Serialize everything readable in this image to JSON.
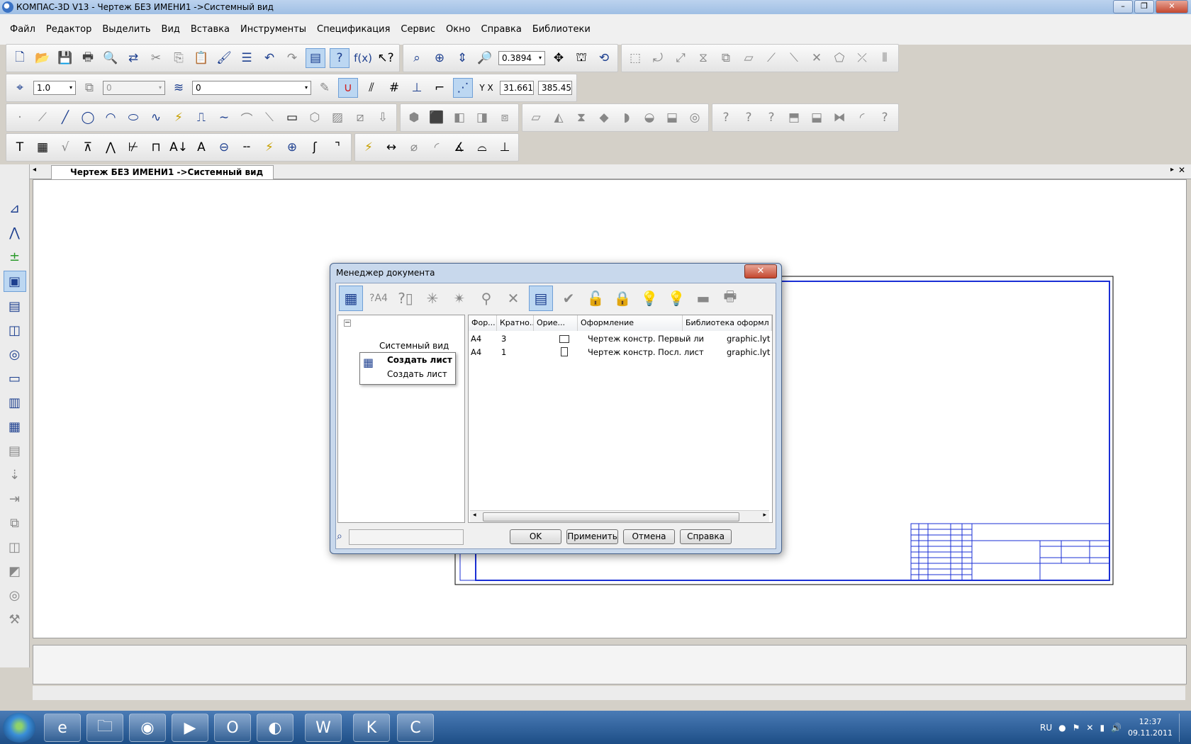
{
  "window": {
    "title": "КОМПАС-3D V13 - Чертеж БЕЗ ИМЕНИ1 ->Системный вид"
  },
  "menu": [
    "Файл",
    "Редактор",
    "Выделить",
    "Вид",
    "Вставка",
    "Инструменты",
    "Спецификация",
    "Сервис",
    "Окно",
    "Справка",
    "Библиотеки"
  ],
  "toolbar": {
    "zoom_value": "0.3894",
    "step_value": "1.0",
    "layer_value": "0",
    "style_value": "0",
    "coord_x": "31.661",
    "coord_y": "385.45"
  },
  "document_tab": "Чертеж БЕЗ ИМЕНИ1 ->Системный вид",
  "dialog": {
    "title": "Менеджер документа",
    "tree": {
      "node_label": "Системный вид"
    },
    "popup": {
      "title": "Создать лист",
      "item": "Создать лист"
    },
    "columns": [
      "Фор...",
      "Кратно...",
      "Орие...",
      "Оформление",
      "Библиотека оформл"
    ],
    "rows": [
      {
        "format": "A4",
        "multiplicity": "3",
        "orientation": "landscape",
        "design": "Чертеж констр. Первый ли",
        "library": "graphic.lyt"
      },
      {
        "format": "A4",
        "multiplicity": "1",
        "orientation": "portrait",
        "design": "Чертеж констр. Посл. лист",
        "library": "graphic.lyt"
      }
    ],
    "buttons": {
      "ok": "OK",
      "apply": "Применить",
      "cancel": "Отмена",
      "help": "Справка"
    }
  },
  "taskbar": {
    "lang": "RU",
    "time": "12:37",
    "date": "09.11.2011"
  },
  "colors": {
    "sheet_frame": "#1a2fd6",
    "title_bar": "#a9c4e8",
    "taskbar": "#2b5e9a"
  }
}
